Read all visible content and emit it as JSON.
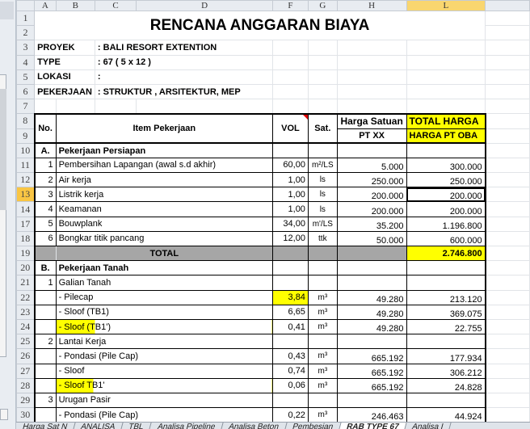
{
  "columns": [
    "A",
    "B",
    "C",
    "D",
    "F",
    "G",
    "H",
    "L"
  ],
  "selected_column": "L",
  "selected_row": "13",
  "title": "RENCANA ANGGARAN BIAYA",
  "info": [
    {
      "row": "3",
      "label": "PROYEK",
      "value": ": BALI RESORT EXTENTION"
    },
    {
      "row": "4",
      "label": "TYPE",
      "value": ": 67 ( 5 x 12 )"
    },
    {
      "row": "5",
      "label": "LOKASI",
      "value": ":"
    },
    {
      "row": "6",
      "label": "PEKERJAAN",
      "value": ": STRUKTUR , ARSITEKTUR, MEP"
    }
  ],
  "header": {
    "no": "No.",
    "item": "Item Pekerjaan",
    "vol": "VOL",
    "sat": "Sat.",
    "harga_satuan": "Harga Satuan",
    "pt_xx": "PT XX",
    "total_harga": "TOTAL HARGA",
    "harga_pt_oba": "HARGA  PT OBA"
  },
  "section_a": {
    "row": "10",
    "no": "A.",
    "title": "Pekerjaan Persiapan"
  },
  "rows_a": [
    {
      "row": "11",
      "no": "1",
      "item": "Pembersihan Lapangan (awal s.d akhir)",
      "vol": "60,00",
      "sat": "m²/LS",
      "harga": "5.000",
      "total": "300.000"
    },
    {
      "row": "12",
      "no": "2",
      "item": "Air kerja",
      "vol": "1,00",
      "sat": "ls",
      "harga": "250.000",
      "total": "250.000"
    },
    {
      "row": "13",
      "no": "3",
      "item": "Listrik kerja",
      "vol": "1,00",
      "sat": "ls",
      "harga": "200.000",
      "total": "200.000"
    },
    {
      "row": "14",
      "no": "4",
      "item": "Keamanan",
      "vol": "1,00",
      "sat": "ls",
      "harga": "200.000",
      "total": "200.000"
    },
    {
      "row": "17",
      "no": "5",
      "item": "Bouwplank",
      "vol": "34,00",
      "sat": "m'/LS",
      "harga": "35.200",
      "total": "1.196.800"
    },
    {
      "row": "18",
      "no": "6",
      "item": "Bongkar titik pancang",
      "vol": "12,00",
      "sat": "ttk",
      "harga": "50.000",
      "total": "600.000"
    }
  ],
  "total": {
    "row": "19",
    "label": "TOTAL",
    "value": "2.746.800"
  },
  "section_b": {
    "row": "20",
    "no": "B.",
    "title": "Pekerjaan Tanah"
  },
  "rows_b": [
    {
      "row": "21",
      "no": "1",
      "item": "Galian Tanah",
      "vol": "",
      "sat": "",
      "harga": "",
      "total": ""
    },
    {
      "row": "22",
      "no": "",
      "item": "- Pilecap",
      "vol": "3,84",
      "sat": "m³",
      "harga": "49.280",
      "total": "213.120"
    },
    {
      "row": "23",
      "no": "",
      "item": "- Sloof (TB1)",
      "vol": "6,65",
      "sat": "m³",
      "harga": "49.280",
      "total": "369.075"
    },
    {
      "row": "24",
      "no": "",
      "item": "- Sloof (TB1')",
      "vol": "0,41",
      "sat": "m³",
      "harga": "49.280",
      "total": "22.755"
    },
    {
      "row": "25",
      "no": "2",
      "item": "Lantai Kerja",
      "vol": "",
      "sat": "",
      "harga": "",
      "total": ""
    },
    {
      "row": "26",
      "no": "",
      "item": "- Pondasi (Pile Cap)",
      "vol": "0,43",
      "sat": "m³",
      "harga": "665.192",
      "total": "177.934"
    },
    {
      "row": "27",
      "no": "",
      "item": "- Sloof",
      "vol": "0,74",
      "sat": "m³",
      "harga": "665.192",
      "total": "306.212"
    },
    {
      "row": "28",
      "no": "",
      "item": "- Sloof TB1'",
      "vol": "0,06",
      "sat": "m³",
      "harga": "665.192",
      "total": "24.828"
    },
    {
      "row": "29",
      "no": "3",
      "item": "Urugan Pasir",
      "vol": "",
      "sat": "",
      "harga": "",
      "total": ""
    },
    {
      "row": "30",
      "no": "",
      "item": "- Pondasi (Pile Cap)",
      "vol": "0,22",
      "sat": "m³",
      "harga": "246.463",
      "total": "44.924"
    }
  ],
  "sheet_tabs": [
    "Harga Sat N",
    "ANALISA",
    "TBL",
    "Analisa Pipeline",
    "Analisa Beton",
    "Pembesian",
    "RAB TYPE 67",
    "Analisa I"
  ],
  "active_tab": "RAB TYPE 67"
}
